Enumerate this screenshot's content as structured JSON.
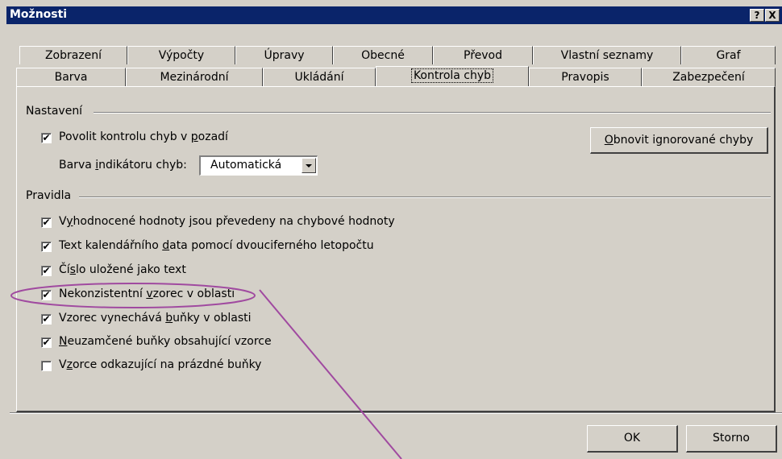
{
  "window": {
    "title": "Možnosti",
    "help_glyph": "?",
    "close_glyph": "X"
  },
  "tabs_row1": [
    "Zobrazení",
    "Výpočty",
    "Úpravy",
    "Obecné",
    "Převod",
    "Vlastní seznamy",
    "Graf"
  ],
  "tabs_row2": [
    "Barva",
    "Mezinárodní",
    "Ukládání",
    "Kontrola chyb",
    "Pravopis",
    "Zabezpečení"
  ],
  "active_tab": "Kontrola chyb",
  "settings": {
    "group_label": "Nastavení",
    "background_check": {
      "checked": true,
      "pre": "Povolit kontrolu chyb v ",
      "acc": "p",
      "post": "ozadí"
    },
    "indicator": {
      "pre": "Barva ",
      "acc": "i",
      "post": "ndikátoru chyb:",
      "value": "Automatická"
    },
    "reset_button": {
      "pre": "",
      "acc": "O",
      "post": "bnovit ignorované chyby"
    }
  },
  "rules": {
    "group_label": "Pravidla",
    "items": [
      {
        "checked": true,
        "pre": "V",
        "acc": "y",
        "post": "hodnocené hodnoty jsou převedeny na chybové hodnoty"
      },
      {
        "checked": true,
        "pre": "Text kalendářního ",
        "acc": "d",
        "post": "ata pomocí dvouciferného letopočtu"
      },
      {
        "checked": true,
        "pre": "Čí",
        "acc": "s",
        "post": "lo uložené jako text"
      },
      {
        "checked": true,
        "pre": "Nekonzistentní ",
        "acc": "v",
        "post": "zorec v oblasti"
      },
      {
        "checked": true,
        "pre": "Vzorec vynechává ",
        "acc": "b",
        "post": "uňky v oblasti"
      },
      {
        "checked": true,
        "pre": "",
        "acc": "N",
        "post": "euzamčené buňky obsahující vzorce"
      },
      {
        "checked": false,
        "pre": "V",
        "acc": "z",
        "post": "orce odkazující na prázdné buňky"
      }
    ]
  },
  "footer": {
    "ok_label": "OK",
    "cancel_label": "Storno"
  },
  "colors": {
    "annotation": "#a04aa0",
    "title_bar": "#0a246a",
    "face": "#d4d0c8"
  }
}
